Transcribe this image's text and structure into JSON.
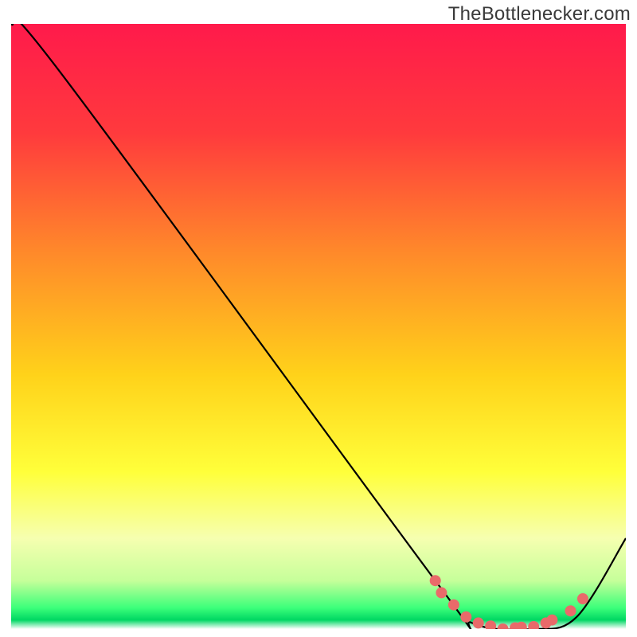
{
  "watermark": "TheBottlenecker.com",
  "chart_data": {
    "type": "line",
    "title": "",
    "xlabel": "",
    "ylabel": "",
    "xlim": [
      0,
      100
    ],
    "ylim": [
      0,
      100
    ],
    "grid": false,
    "legend": false,
    "series": [
      {
        "name": "curve",
        "x": [
          0,
          8,
          69,
          75,
          85,
          92,
          100
        ],
        "y": [
          100,
          92,
          8,
          1,
          0,
          2,
          15
        ]
      }
    ],
    "markers": {
      "name": "dots",
      "x": [
        69,
        70,
        72,
        74,
        76,
        78,
        80,
        82,
        83,
        85,
        87,
        88,
        91,
        93
      ],
      "y": [
        8,
        6,
        4,
        2,
        1,
        0.5,
        0,
        0.2,
        0.3,
        0.4,
        1,
        1.5,
        3,
        5
      ]
    },
    "gradient_stops": [
      {
        "offset": 0.0,
        "color": "#ff1a4b"
      },
      {
        "offset": 0.18,
        "color": "#ff3a3d"
      },
      {
        "offset": 0.38,
        "color": "#ff8a2a"
      },
      {
        "offset": 0.58,
        "color": "#ffd21a"
      },
      {
        "offset": 0.74,
        "color": "#ffff3a"
      },
      {
        "offset": 0.85,
        "color": "#f6ffb0"
      },
      {
        "offset": 0.92,
        "color": "#c6ff9a"
      },
      {
        "offset": 0.965,
        "color": "#3cff7a"
      },
      {
        "offset": 0.985,
        "color": "#00d763"
      },
      {
        "offset": 1.0,
        "color": "#ffffff"
      }
    ],
    "line_color": "#000000",
    "marker_color": "#e96a6a",
    "marker_radius": 7
  }
}
